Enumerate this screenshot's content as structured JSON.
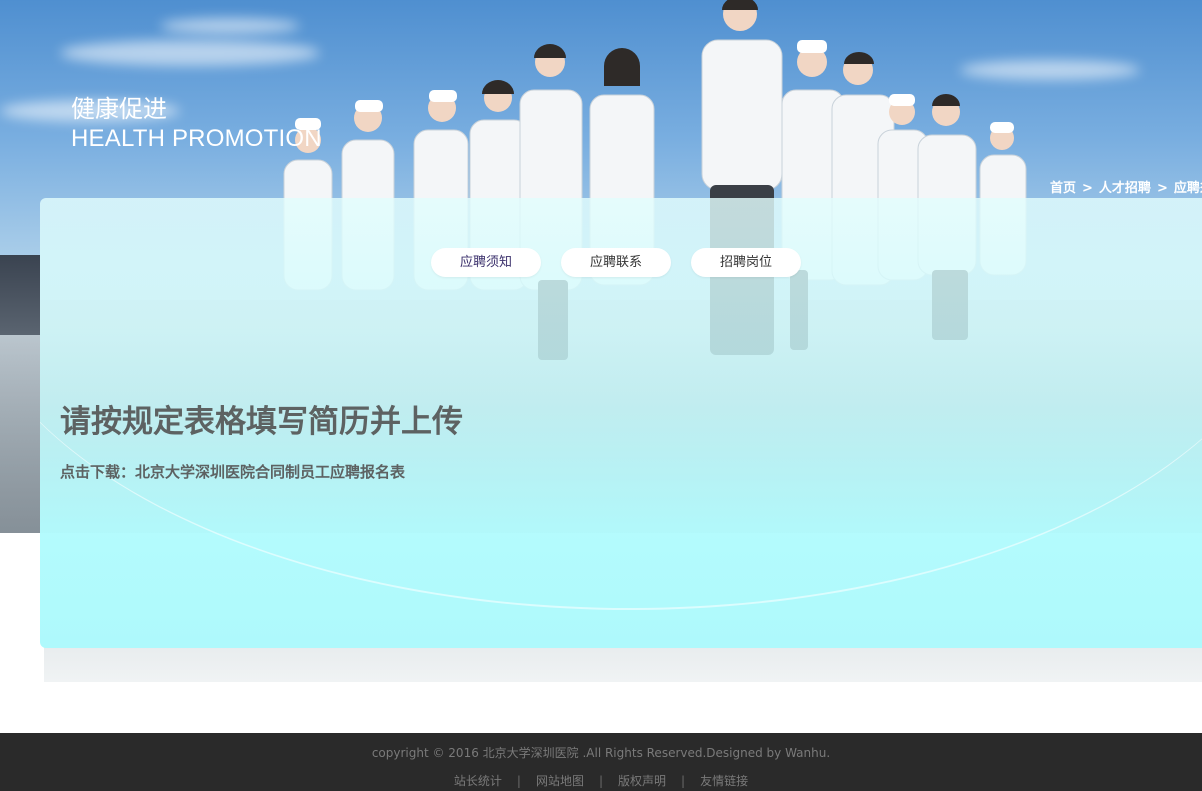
{
  "hero": {
    "title": "健康促进",
    "subtitle": "HEALTH PROMOTION"
  },
  "breadcrumb": {
    "items": [
      "首页",
      "人才招聘",
      "应聘须知"
    ],
    "separator": ">"
  },
  "tabs": [
    {
      "label": "应聘须知",
      "active": true
    },
    {
      "label": "应聘联系",
      "active": false
    },
    {
      "label": "招聘岗位",
      "active": false
    }
  ],
  "content": {
    "title": "请按规定表格填写简历并上传",
    "download_prefix": "点击下载：",
    "download_link": "北京大学深圳医院合同制员工应聘报名表"
  },
  "footer": {
    "copyright": "copyright © 2016 北京大学深圳医院 .All Rights Reserved.Designed by Wanhu.",
    "links": [
      "站长统计",
      "网站地图",
      "版权声明",
      "友情链接"
    ],
    "separator": "|"
  },
  "colors": {
    "panel": "#aef9fc",
    "heading": "#5d6262",
    "footer_bg": "#2a2a2a"
  }
}
